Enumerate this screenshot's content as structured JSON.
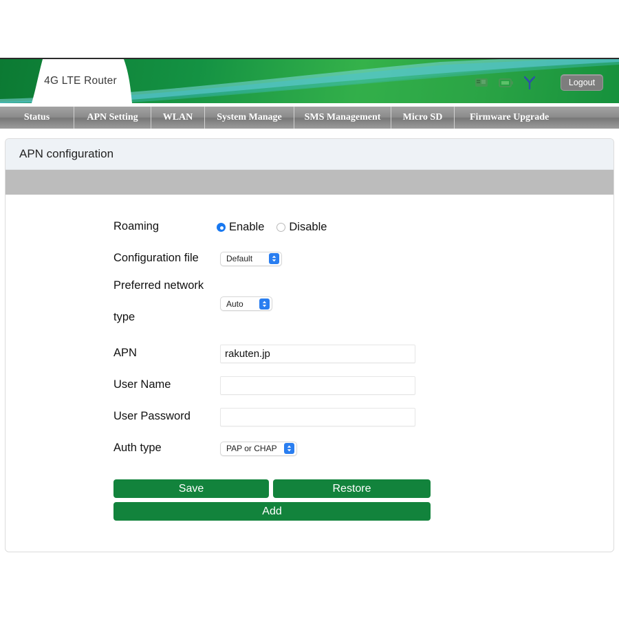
{
  "header": {
    "logo_text": "4G LTE Router",
    "logout_label": "Logout",
    "icons": [
      "sd-card-icon",
      "battery-icon",
      "signal-antenna-icon"
    ],
    "accent_green": "#12833c",
    "banner_green_dark": "#0c7a33",
    "banner_green_light": "#35b24a",
    "swoosh_color": "#6fd3e0"
  },
  "nav": {
    "tabs": [
      {
        "label": "Status"
      },
      {
        "label": "APN Setting"
      },
      {
        "label": "WLAN"
      },
      {
        "label": "System Manage"
      },
      {
        "label": "SMS Management"
      },
      {
        "label": "Micro SD"
      },
      {
        "label": "Firmware Upgrade"
      }
    ]
  },
  "panel": {
    "title": "APN configuration"
  },
  "form": {
    "roaming": {
      "label": "Roaming",
      "enable_label": "Enable",
      "disable_label": "Disable",
      "selected": "Enable"
    },
    "config_file": {
      "label": "Configuration file",
      "value": "Default"
    },
    "preferred_network_type": {
      "label_line1": "Preferred network",
      "label_line2": "type",
      "value": "Auto"
    },
    "apn": {
      "label": "APN",
      "value": "rakuten.jp",
      "placeholder": ""
    },
    "user_name": {
      "label": "User Name",
      "value": "",
      "placeholder": ""
    },
    "user_password": {
      "label": "User Password",
      "value": "",
      "placeholder": ""
    },
    "auth_type": {
      "label": "Auth type",
      "value": "PAP or CHAP"
    },
    "buttons": {
      "save": "Save",
      "restore": "Restore",
      "add": "Add"
    }
  }
}
